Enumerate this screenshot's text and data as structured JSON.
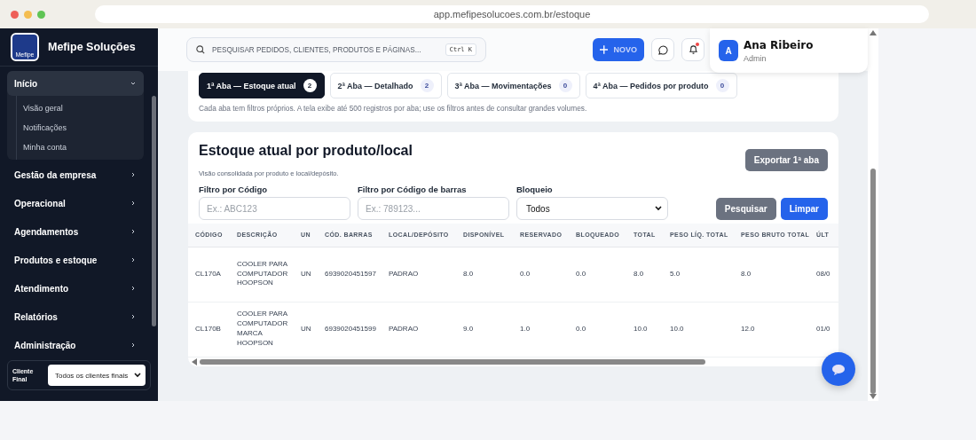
{
  "browser": {
    "url": "app.mefipesolucoes.com.br/estoque"
  },
  "sidebar": {
    "brand": "Mefipe Soluções",
    "logo_text": "Mefipe",
    "items": [
      {
        "label": "Início",
        "expanded": true,
        "children": [
          {
            "label": "Visão geral"
          },
          {
            "label": "Notificações"
          },
          {
            "label": "Minha conta"
          }
        ]
      },
      {
        "label": "Gestão da empresa",
        "expanded": false
      },
      {
        "label": "Operacional",
        "expanded": false
      },
      {
        "label": "Agendamentos",
        "expanded": false
      },
      {
        "label": "Produtos e estoque",
        "expanded": false
      },
      {
        "label": "Atendimento",
        "expanded": false
      },
      {
        "label": "Relatórios",
        "expanded": false
      },
      {
        "label": "Administração",
        "expanded": false
      }
    ],
    "client_filter": {
      "label": "Cliente Final",
      "value": "Todos os clientes finais"
    }
  },
  "topbar": {
    "search_placeholder": "PESQUISAR PEDIDOS, CLIENTES, PRODUTOS E PÁGINAS...",
    "shortcut": "Ctrl K",
    "new_button": "NOVO",
    "notification_dot": true,
    "user": {
      "initial": "A",
      "name": "Ana Ribeiro",
      "role": "Admin"
    }
  },
  "tabs": [
    {
      "label": "1ª Aba — Estoque atual",
      "count": "2",
      "selected": true
    },
    {
      "label": "2ª Aba — Detalhado",
      "count": "2",
      "selected": false
    },
    {
      "label": "3ª Aba — Movimentações",
      "count": "0",
      "selected": false
    },
    {
      "label": "4ª Aba — Pedidos por produto",
      "count": "0",
      "selected": false
    }
  ],
  "tabs_note": "Cada aba tem filtros próprios. A tela exibe até 500 registros por aba; use os filtros antes de consultar grandes volumes.",
  "panel": {
    "title": "Estoque atual por produto/local",
    "subtitle": "Visão consolidada por produto e local/depósito.",
    "export_button": "Exportar 1ª aba",
    "filters": [
      {
        "kind": "text",
        "label": "Filtro por Código",
        "placeholder": "Ex.: ABC123"
      },
      {
        "kind": "text",
        "label": "Filtro por Código de barras",
        "placeholder": "Ex.: 789123..."
      },
      {
        "kind": "select",
        "label": "Bloqueio",
        "value": "Todos"
      }
    ],
    "search_button": "Pesquisar",
    "clear_button": "Limpar"
  },
  "table": {
    "columns": [
      "CÓDIGO",
      "DESCRIÇÃO",
      "UN",
      "CÓD. BARRAS",
      "LOCAL/DEPÓSITO",
      "DISPONÍVEL",
      "RESERVADO",
      "BLOQUEADO",
      "TOTAL",
      "PESO LÍQ. TOTAL",
      "PESO BRUTO TOTAL",
      "ÚLT"
    ],
    "rows": [
      [
        "CL170A",
        "COOLER PARA COMPUTADOR HOOPSON",
        "UN",
        "6939020451597",
        "PADRAO",
        "8.0",
        "0.0",
        "0.0",
        "8.0",
        "5.0",
        "8.0",
        "08/0"
      ],
      [
        "CL170B",
        "COOLER PARA COMPUTADOR MARCA HOOPSON",
        "UN",
        "6939020451599",
        "PADRAO",
        "9.0",
        "1.0",
        "0.0",
        "10.0",
        "10.0",
        "12.0",
        "01/0"
      ]
    ]
  }
}
